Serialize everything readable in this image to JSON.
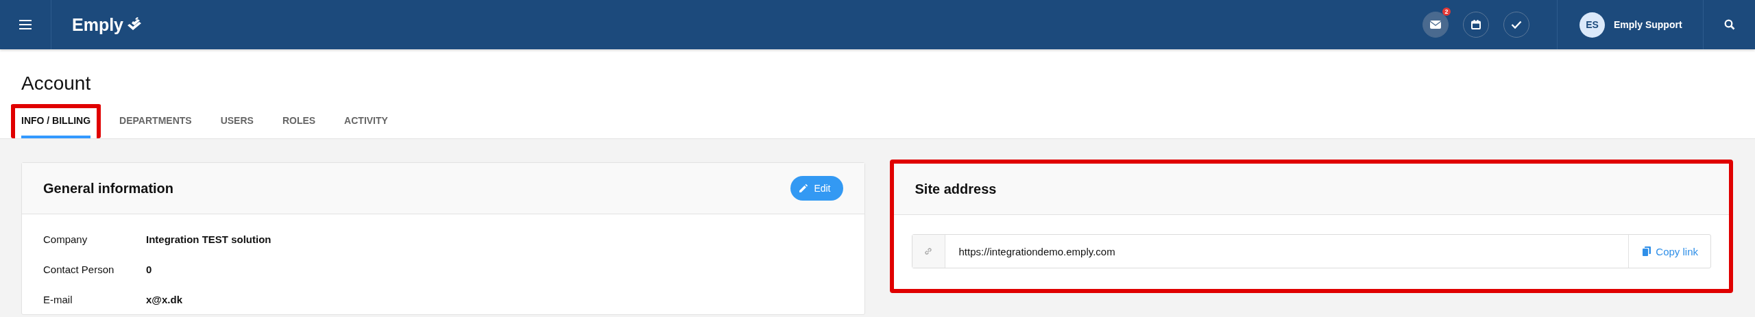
{
  "top_bar": {
    "logo": "Emply",
    "notifications": [
      {
        "kind": "mail",
        "badge": "2",
        "selected": true
      },
      {
        "kind": "calendar",
        "selected": false
      },
      {
        "kind": "tasks",
        "selected": false
      }
    ],
    "user": {
      "initials": "ES",
      "name": "Emply Support"
    }
  },
  "page": {
    "title": "Account"
  },
  "tabs": [
    {
      "label": "INFO / BILLING",
      "selected": true,
      "highlighted": true
    },
    {
      "label": "DEPARTMENTS",
      "selected": false,
      "highlighted": false
    },
    {
      "label": "USERS",
      "selected": false,
      "highlighted": false
    },
    {
      "label": "ROLES",
      "selected": false,
      "highlighted": false
    },
    {
      "label": "ACTIVITY",
      "selected": false,
      "highlighted": false
    }
  ],
  "general_information": {
    "title": "General information",
    "edit_button": "Edit",
    "highlighted": false,
    "fields": [
      {
        "label": "Company",
        "value": "Integration TEST solution"
      },
      {
        "label": "Contact Person",
        "value": "0"
      },
      {
        "label": "E-mail",
        "value": "x@x.dk"
      }
    ]
  },
  "site_address": {
    "title": "Site address",
    "highlighted": true,
    "url": "https://integrationdemo.emply.com",
    "copy_button": "Copy link"
  }
}
